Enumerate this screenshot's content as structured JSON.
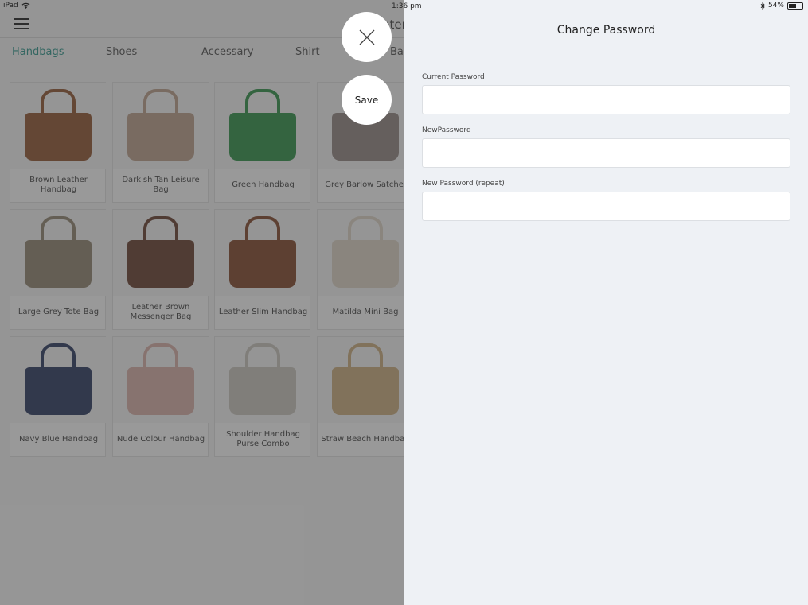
{
  "status_bar": {
    "device": "iPad",
    "time": "1:36 pm",
    "battery": "54%",
    "battery_level": 0.54
  },
  "header": {
    "title_partial": "nter"
  },
  "tabs": [
    {
      "label": "Handbags",
      "active": true
    },
    {
      "label": "Shoes",
      "active": false
    },
    {
      "label": "Accessary",
      "active": false
    },
    {
      "label": "Shirt",
      "active": false
    },
    {
      "label": "Bag",
      "active": false
    }
  ],
  "products": [
    {
      "name": "Brown Leather Handbag",
      "color": "#8b4a22"
    },
    {
      "name": "Darkish Tan Leisure Bag",
      "color": "#b89a84"
    },
    {
      "name": "Green Handbag",
      "color": "#1f8a3a"
    },
    {
      "name": "Grey Barlow Satchel",
      "color": "#8d7f7a"
    },
    {
      "name": "Large Grey Tote Bag",
      "color": "#8a7d66"
    },
    {
      "name": "Leather Brown Messenger Bag",
      "color": "#5e3220"
    },
    {
      "name": "Leather Slim Handbag",
      "color": "#7a3b1c"
    },
    {
      "name": "Matilda Mini Bag",
      "color": "#ddd3c4"
    },
    {
      "name": "Navy Blue Handbag",
      "color": "#1c2a55"
    },
    {
      "name": "Nude Colour Handbag",
      "color": "#d8aaa2"
    },
    {
      "name": "Shoulder Handbag Purse Combo",
      "color": "#c8c4bb"
    },
    {
      "name": "Straw Beach Handbag",
      "color": "#c9a877"
    }
  ],
  "panel": {
    "title": "Change Password",
    "fields": [
      {
        "label": "Current Password",
        "value": "",
        "placeholder": ""
      },
      {
        "label": "NewPassword",
        "value": "",
        "placeholder": ""
      },
      {
        "label": "New Password (repeat)",
        "value": "",
        "placeholder": ""
      }
    ]
  },
  "buttons": {
    "save_label": "Save",
    "close_icon": "close-icon"
  }
}
